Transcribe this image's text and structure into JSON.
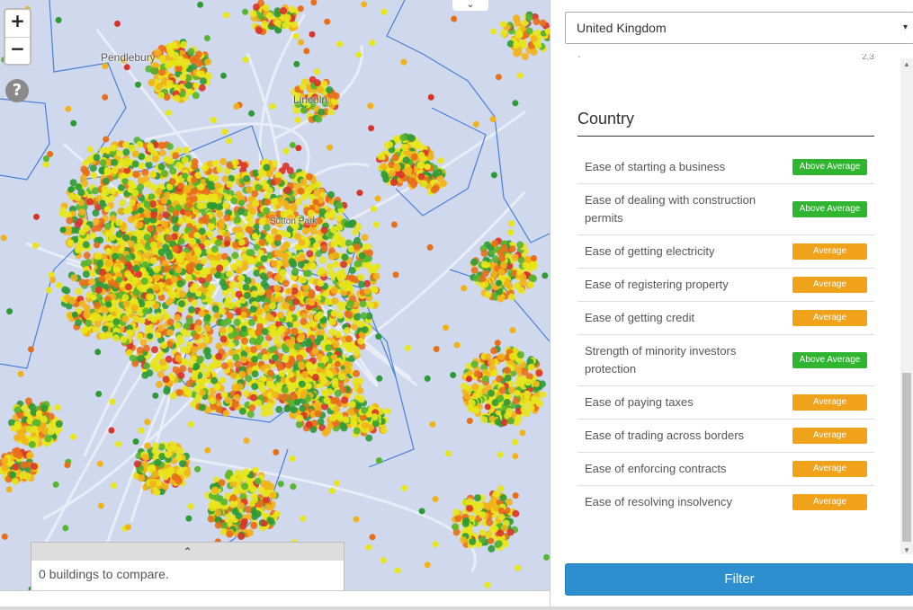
{
  "map": {
    "zoom_in": "+",
    "zoom_out": "−",
    "help": "?",
    "toggle_glyph": "⌄",
    "next_glyph": "›",
    "places": [
      "Pendlebury",
      "Lincoln",
      "Sutton Park"
    ],
    "marker_colors": [
      "#e8e61a",
      "#f2b21a",
      "#e86f1a",
      "#d9332a",
      "#2e9a36",
      "#57b52f"
    ],
    "boundary_color": "#4a7fd8",
    "compare": {
      "handle": "⌃",
      "text": "0 buildings to compare."
    }
  },
  "panel": {
    "country_select": {
      "value": "United Kingdom",
      "arrow": "▾"
    },
    "fragment": {
      "left": "-",
      "right": "2,3"
    },
    "section_title": "Country",
    "indicators": [
      {
        "label": "Ease of starting a business",
        "rating": "Above Average",
        "color": "#2fb52f"
      },
      {
        "label": "Ease of dealing with construction permits",
        "rating": "Above Average",
        "color": "#2fb52f"
      },
      {
        "label": "Ease of getting electricity",
        "rating": "Average",
        "color": "#f0a21a"
      },
      {
        "label": "Ease of registering property",
        "rating": "Average",
        "color": "#f0a21a"
      },
      {
        "label": "Ease of getting credit",
        "rating": "Average",
        "color": "#f0a21a"
      },
      {
        "label": "Strength of minority investors protection",
        "rating": "Above Average",
        "color": "#2fb52f"
      },
      {
        "label": "Ease of paying taxes",
        "rating": "Average",
        "color": "#f0a21a"
      },
      {
        "label": "Ease of trading across borders",
        "rating": "Average",
        "color": "#f0a21a"
      },
      {
        "label": "Ease of enforcing contracts",
        "rating": "Average",
        "color": "#f0a21a"
      },
      {
        "label": "Ease of resolving insolvency",
        "rating": "Average",
        "color": "#f0a21a"
      }
    ],
    "filter_label": "Filter"
  }
}
